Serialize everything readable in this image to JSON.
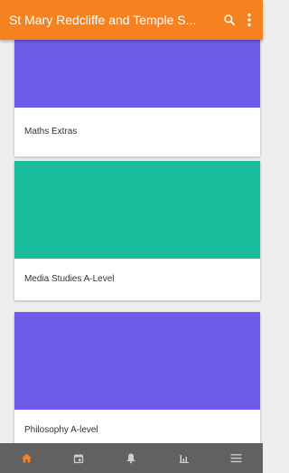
{
  "appbar": {
    "title": "St Mary Redcliffe and Temple S...",
    "background": "#f5821f",
    "icons": [
      "search-icon",
      "more-vert-icon"
    ]
  },
  "cards": [
    {
      "title": "Maths Extras",
      "banner_color": "#6c5ce7"
    },
    {
      "title": "Media Studies A-Level",
      "banner_color": "#1abc9c"
    },
    {
      "title": "Philosophy A-level",
      "banner_color": "#6c5ce7"
    }
  ],
  "bottom_nav": {
    "background": "#616161",
    "active_color": "#f5821f",
    "inactive_color": "#cfcfcf",
    "items": [
      "home-icon",
      "calendar-icon",
      "bell-icon",
      "chart-icon",
      "menu-icon"
    ]
  }
}
